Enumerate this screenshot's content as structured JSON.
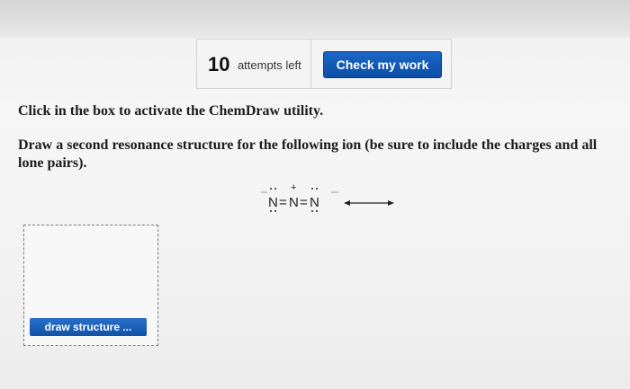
{
  "toolbar": {
    "attempts_count": "10",
    "attempts_label": "attempts left",
    "check_button_label": "Check my work"
  },
  "main": {
    "instruction": "Click in the box to activate the ChemDraw utility.",
    "question": "Draw a second resonance structure for the following ion (be sure to include the charges and all lone pairs).",
    "ion": {
      "atom1": "N",
      "atom2": "N",
      "atom3": "N",
      "charge_center": "+",
      "bond1": "=",
      "bond2": "="
    },
    "draw_button_label": "draw structure ..."
  },
  "icons": {
    "arrow": "resonance-arrow-icon"
  },
  "colors": {
    "button_blue": "#0f52a8"
  }
}
